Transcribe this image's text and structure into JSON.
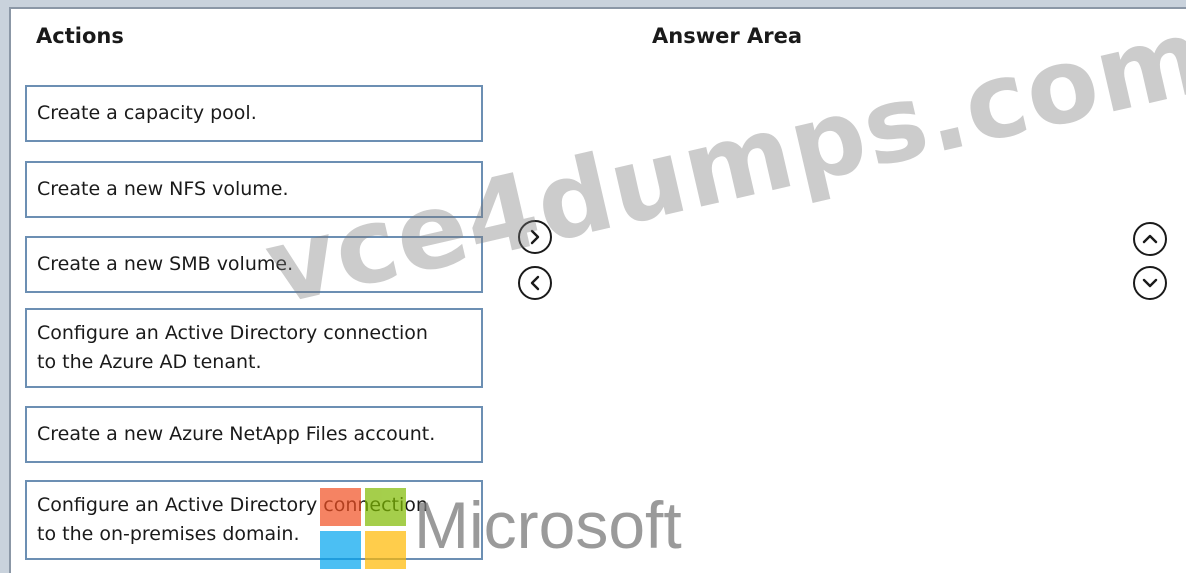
{
  "headings": {
    "actions": "Actions",
    "answer_area": "Answer Area"
  },
  "actions": [
    {
      "line1": "Create a capacity pool.",
      "line2": ""
    },
    {
      "line1": "Create a new NFS volume.",
      "line2": ""
    },
    {
      "line1": "Create a new SMB volume.",
      "line2": ""
    },
    {
      "line1": "Configure an Active Directory connection",
      "line2": "to the Azure AD tenant."
    },
    {
      "line1": "Create a new Azure NetApp Files account.",
      "line2": ""
    },
    {
      "line1": "Configure an Active Directory connection",
      "line2": "to the on-premises domain."
    }
  ],
  "controls": {
    "move_right_icon": "chevron-right-icon",
    "move_left_icon": "chevron-left-icon",
    "move_up_icon": "chevron-up-icon",
    "move_down_icon": "chevron-down-icon"
  },
  "watermark": {
    "site": "vce4dumps.com",
    "brand": "Microsoft"
  },
  "colors": {
    "box_border": "#6c8fb3",
    "frame": "#c9d2dc",
    "ms_red": "#f25022",
    "ms_green": "#7fba00",
    "ms_blue": "#00a4ef",
    "ms_yellow": "#ffb900"
  }
}
